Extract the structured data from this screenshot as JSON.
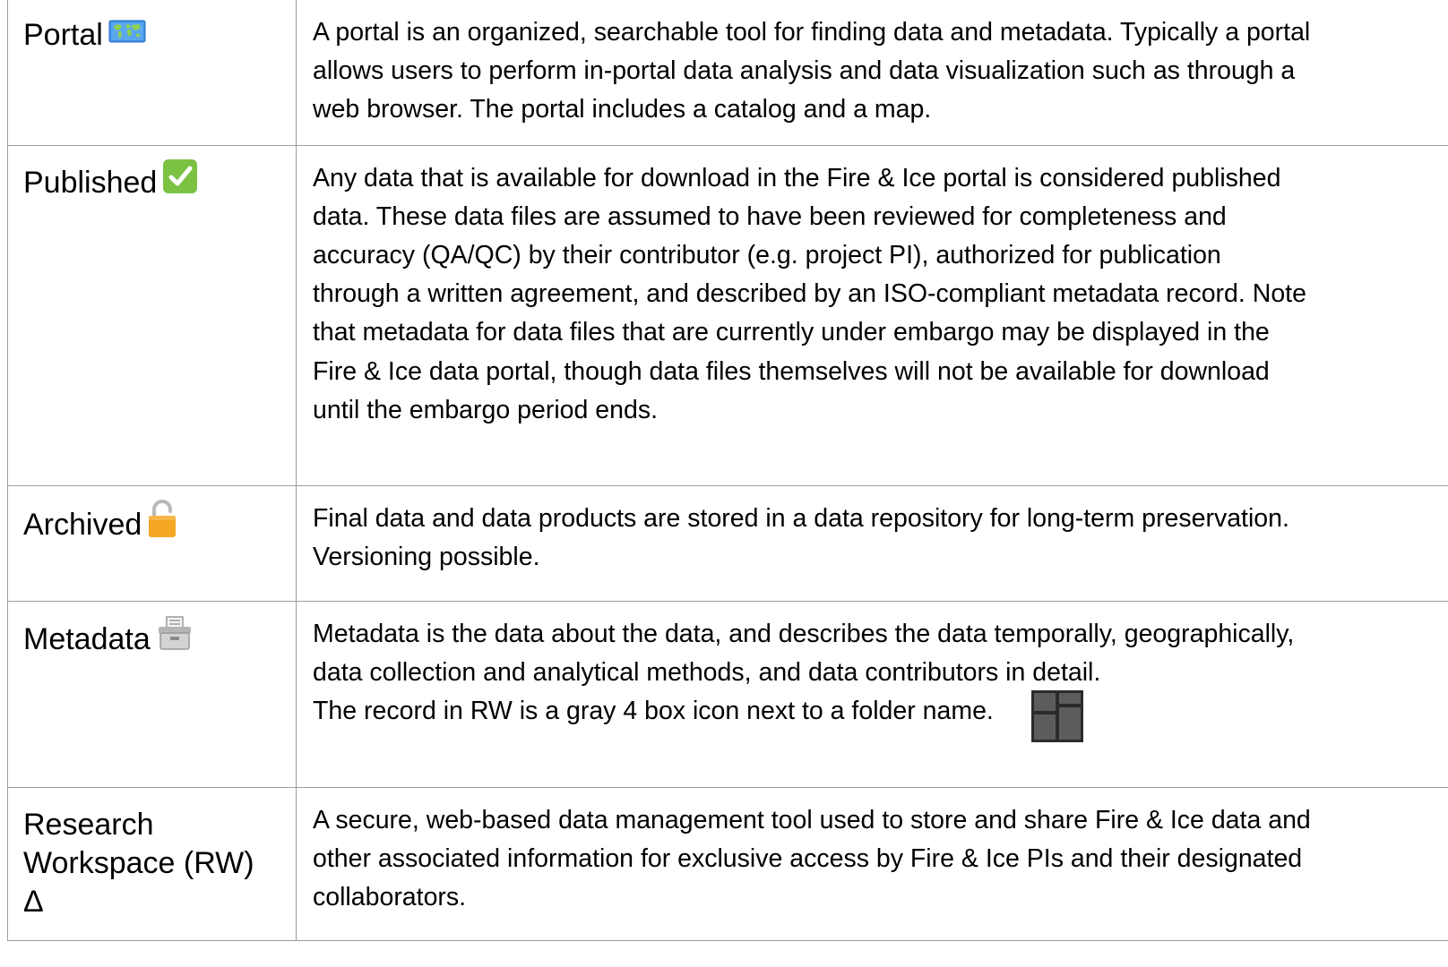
{
  "rows": [
    {
      "term": "Portal",
      "icon": "world-map-icon",
      "definition_lines": [
        "A portal is an organized, searchable tool for finding data and metadata. Typically a portal",
        "allows users to perform in-portal data analysis and data visualization such as through a",
        "web browser. The portal includes a catalog and a map."
      ]
    },
    {
      "term": "Published",
      "icon": "check-mark-icon",
      "definition_lines": [
        "Any data that is available for download in the Fire & Ice portal is considered published",
        "data. These data files are assumed to have been reviewed for completeness and",
        "accuracy (QA/QC) by their contributor (e.g. project PI), authorized for publication",
        "through a written agreement, and described by an ISO-compliant metadata record. Note",
        "that metadata for data files that are currently under embargo may be displayed in the",
        "Fire & Ice data portal, though data files themselves will not be available for download",
        "until the embargo period ends."
      ]
    },
    {
      "term": "Archived",
      "icon": "lock-icon",
      "definition_lines": [
        "Final data and data products are stored in a data repository for long-term preservation.",
        "Versioning possible."
      ]
    },
    {
      "term": "Metadata",
      "icon": "card-file-box-icon",
      "definition_lines": [
        "Metadata is the data about the data, and describes the data temporally, geographically,",
        "data collection and analytical methods, and data contributors in detail.",
        "The record in RW is a gray 4 box icon next to a folder name."
      ],
      "inline_icon": "gray-four-box-icon"
    },
    {
      "term_lines": [
        "Research",
        "Workspace (RW)",
        "Δ"
      ],
      "definition_lines": [
        "A secure, web-based data management tool used to store and share Fire & Ice data and",
        "other associated information for exclusive access by Fire & Ice PIs and their designated",
        "collaborators."
      ]
    }
  ],
  "colors": {
    "border": "#9e9e9e",
    "text": "#000000",
    "check_green": "#7cc242",
    "lock_orange": "#f5a623",
    "box_gray": "#4a4a4a"
  }
}
